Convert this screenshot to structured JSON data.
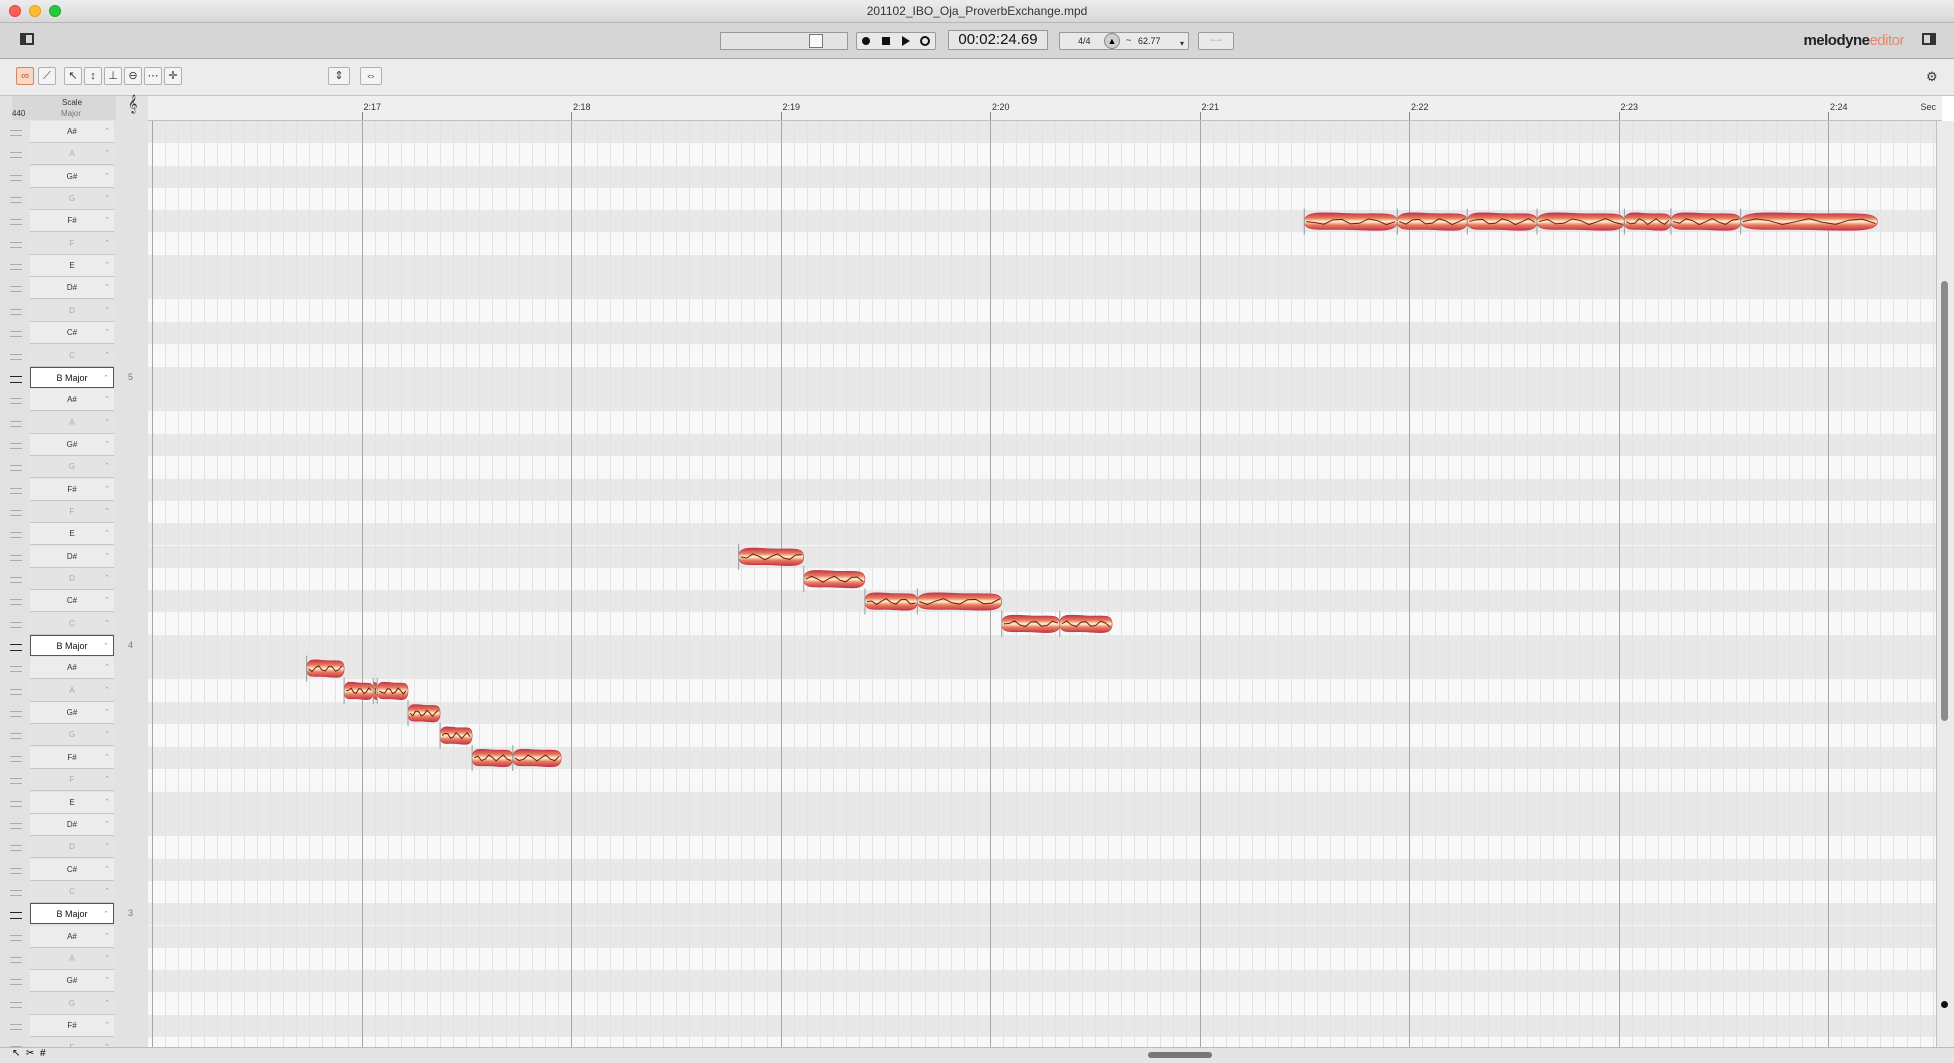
{
  "window": {
    "title": "201102_IBO_Oja_ProverbExchange.mpd"
  },
  "transport": {
    "time": "00:02:24.69",
    "meter": "4/4",
    "tempo": "62.77"
  },
  "brand": {
    "name": "melodyne",
    "edition": "editor"
  },
  "pitch_header": {
    "scale_label": "Scale",
    "mode_label": "Major",
    "ref_pitch": "440",
    "unit_label": "Sec"
  },
  "ruler": {
    "ticks": [
      "2:17",
      "2:18",
      "2:19",
      "2:20",
      "2:21",
      "2:22",
      "2:23",
      "2:24"
    ]
  },
  "keyboard": [
    {
      "label": "A#",
      "type": "lit"
    },
    {
      "label": "A",
      "type": "dim"
    },
    {
      "label": "G#",
      "type": "lit"
    },
    {
      "label": "G",
      "type": "dim"
    },
    {
      "label": "F#",
      "type": "lit"
    },
    {
      "label": "F",
      "type": "dim"
    },
    {
      "label": "E",
      "type": "lit"
    },
    {
      "label": "D#",
      "type": "lit"
    },
    {
      "label": "D",
      "type": "dim"
    },
    {
      "label": "C#",
      "type": "lit"
    },
    {
      "label": "C",
      "type": "dim"
    },
    {
      "label": "B Major",
      "type": "scale",
      "octave": "5"
    },
    {
      "label": "A#",
      "type": "lit"
    },
    {
      "label": "A",
      "type": "dim"
    },
    {
      "label": "G#",
      "type": "lit"
    },
    {
      "label": "G",
      "type": "dim"
    },
    {
      "label": "F#",
      "type": "lit"
    },
    {
      "label": "F",
      "type": "dim"
    },
    {
      "label": "E",
      "type": "lit"
    },
    {
      "label": "D#",
      "type": "lit"
    },
    {
      "label": "D",
      "type": "dim"
    },
    {
      "label": "C#",
      "type": "lit"
    },
    {
      "label": "C",
      "type": "dim"
    },
    {
      "label": "B Major",
      "type": "scale",
      "octave": "4"
    },
    {
      "label": "A#",
      "type": "lit"
    },
    {
      "label": "A",
      "type": "dim"
    },
    {
      "label": "G#",
      "type": "lit"
    },
    {
      "label": "G",
      "type": "dim"
    },
    {
      "label": "F#",
      "type": "lit"
    },
    {
      "label": "F",
      "type": "dim"
    },
    {
      "label": "E",
      "type": "lit"
    },
    {
      "label": "D#",
      "type": "lit"
    },
    {
      "label": "D",
      "type": "dim"
    },
    {
      "label": "C#",
      "type": "lit"
    },
    {
      "label": "C",
      "type": "dim"
    },
    {
      "label": "B Major",
      "type": "scale",
      "octave": "3"
    },
    {
      "label": "A#",
      "type": "lit"
    },
    {
      "label": "A",
      "type": "dim"
    },
    {
      "label": "G#",
      "type": "lit"
    },
    {
      "label": "G",
      "type": "dim"
    },
    {
      "label": "F#",
      "type": "lit"
    },
    {
      "label": "F",
      "type": "dim"
    }
  ],
  "blobs": [
    {
      "start": 136.738,
      "end": 136.917,
      "pitch": "A#3"
    },
    {
      "start": 136.917,
      "end": 137.056,
      "pitch": "A3"
    },
    {
      "start": 137.056,
      "end": 137.075,
      "pitch": "A3"
    },
    {
      "start": 137.075,
      "end": 137.222,
      "pitch": "A3"
    },
    {
      "start": 137.222,
      "end": 137.375,
      "pitch": "G#3"
    },
    {
      "start": 137.375,
      "end": 137.528,
      "pitch": "G3"
    },
    {
      "start": 137.528,
      "end": 137.722,
      "pitch": "F#3"
    },
    {
      "start": 137.722,
      "end": 137.953,
      "pitch": "F#3"
    },
    {
      "start": 138.8,
      "end": 139.111,
      "pitch": "D#4"
    },
    {
      "start": 139.111,
      "end": 139.403,
      "pitch": "D4"
    },
    {
      "start": 139.403,
      "end": 139.653,
      "pitch": "C#4"
    },
    {
      "start": 139.653,
      "end": 140.056,
      "pitch": "C#4"
    },
    {
      "start": 140.056,
      "end": 140.333,
      "pitch": "C4"
    },
    {
      "start": 140.333,
      "end": 140.583,
      "pitch": "C4"
    },
    {
      "start": 141.5,
      "end": 141.944,
      "pitch": "F#5"
    },
    {
      "start": 141.944,
      "end": 142.278,
      "pitch": "F#5"
    },
    {
      "start": 142.278,
      "end": 142.611,
      "pitch": "F#5"
    },
    {
      "start": 142.611,
      "end": 143.028,
      "pitch": "F#5"
    },
    {
      "start": 143.028,
      "end": 143.25,
      "pitch": "F#5"
    },
    {
      "start": 143.25,
      "end": 143.583,
      "pitch": "F#5"
    },
    {
      "start": 143.583,
      "end": 144.236,
      "pitch": "F#5"
    }
  ],
  "colors": {
    "blob_outer": "#c2334b",
    "blob_inner": "#fff2cf",
    "blob_mid": "#e87a5a",
    "pitch_curve": "#6a1d17"
  },
  "icons": {
    "left_toggle": "sidebar-icon",
    "record": "record-icon",
    "stop": "stop-icon",
    "play": "play-icon",
    "loop": "loop-icon",
    "metronome": "metronome-icon",
    "settings": "gear-icon",
    "right_toggle": "inspector-icon"
  }
}
